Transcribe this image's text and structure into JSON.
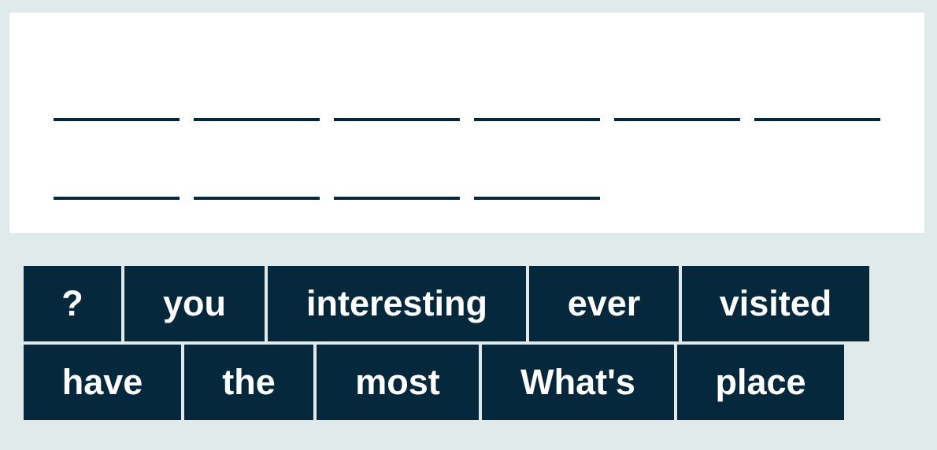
{
  "palette": {
    "background": "#e1eaeb",
    "answer_area": "#ffffff",
    "tile": "#06283d",
    "tile_text": "#ffffff",
    "blank_line": "#06283d"
  },
  "answer": {
    "blank_count": 10
  },
  "word_bank": {
    "tiles": [
      "?",
      "you",
      "interesting",
      "ever",
      "visited",
      "have",
      "the",
      "most",
      "What's",
      "place"
    ]
  }
}
